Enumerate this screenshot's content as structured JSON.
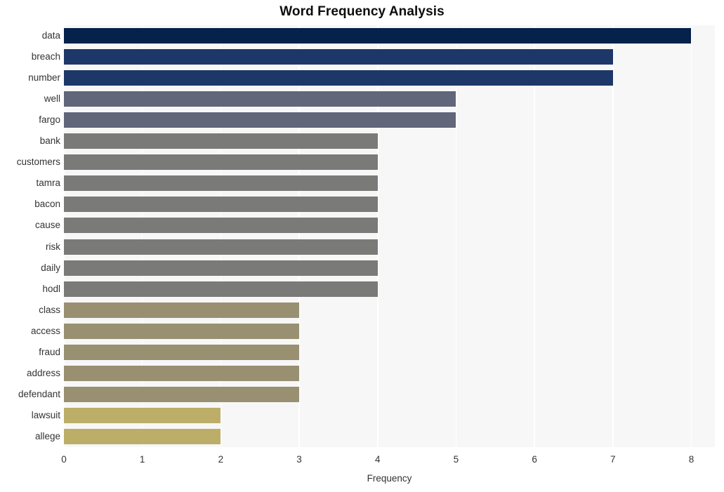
{
  "chart_data": {
    "type": "bar",
    "orientation": "horizontal",
    "title": "Word Frequency Analysis",
    "xlabel": "Frequency",
    "ylabel": "",
    "xlim": [
      0,
      8.3
    ],
    "xticks": [
      0,
      1,
      2,
      3,
      4,
      5,
      6,
      7,
      8
    ],
    "xtick_labels": [
      "0",
      "1",
      "2",
      "3",
      "4",
      "5",
      "6",
      "7",
      "8"
    ],
    "grid": "vertical-white-on-light-gray",
    "legend": "none",
    "categories": [
      "data",
      "breach",
      "number",
      "well",
      "fargo",
      "bank",
      "customers",
      "tamra",
      "bacon",
      "cause",
      "risk",
      "daily",
      "hodl",
      "class",
      "access",
      "fraud",
      "address",
      "defendant",
      "lawsuit",
      "allege"
    ],
    "values": [
      8,
      7,
      7,
      5,
      5,
      4,
      4,
      4,
      4,
      4,
      4,
      4,
      4,
      3,
      3,
      3,
      3,
      3,
      2,
      2
    ],
    "bar_colors": [
      "#05224a",
      "#1e3769",
      "#1e3769",
      "#61667a",
      "#61667a",
      "#7a7a78",
      "#7a7a78",
      "#7a7a78",
      "#7a7a78",
      "#7a7a78",
      "#7a7a78",
      "#7a7a78",
      "#7a7a78",
      "#999072",
      "#999072",
      "#999072",
      "#999072",
      "#999072",
      "#bcae68",
      "#bcae68"
    ],
    "bars": [
      {
        "label": "data",
        "value": 8,
        "color": "#05224a"
      },
      {
        "label": "breach",
        "value": 7,
        "color": "#1e3769"
      },
      {
        "label": "number",
        "value": 7,
        "color": "#1e3769"
      },
      {
        "label": "well",
        "value": 5,
        "color": "#61667a"
      },
      {
        "label": "fargo",
        "value": 5,
        "color": "#61667a"
      },
      {
        "label": "bank",
        "value": 4,
        "color": "#7a7a78"
      },
      {
        "label": "customers",
        "value": 4,
        "color": "#7a7a78"
      },
      {
        "label": "tamra",
        "value": 4,
        "color": "#7a7a78"
      },
      {
        "label": "bacon",
        "value": 4,
        "color": "#7a7a78"
      },
      {
        "label": "cause",
        "value": 4,
        "color": "#7a7a78"
      },
      {
        "label": "risk",
        "value": 4,
        "color": "#7a7a78"
      },
      {
        "label": "daily",
        "value": 4,
        "color": "#7a7a78"
      },
      {
        "label": "hodl",
        "value": 4,
        "color": "#7a7a78"
      },
      {
        "label": "class",
        "value": 3,
        "color": "#999072"
      },
      {
        "label": "access",
        "value": 3,
        "color": "#999072"
      },
      {
        "label": "fraud",
        "value": 3,
        "color": "#999072"
      },
      {
        "label": "address",
        "value": 3,
        "color": "#999072"
      },
      {
        "label": "defendant",
        "value": 3,
        "color": "#999072"
      },
      {
        "label": "lawsuit",
        "value": 2,
        "color": "#bcae68"
      },
      {
        "label": "allege",
        "value": 2,
        "color": "#bcae68"
      }
    ],
    "plot_background": "#f7f7f7",
    "figure_background": "#ffffff"
  }
}
